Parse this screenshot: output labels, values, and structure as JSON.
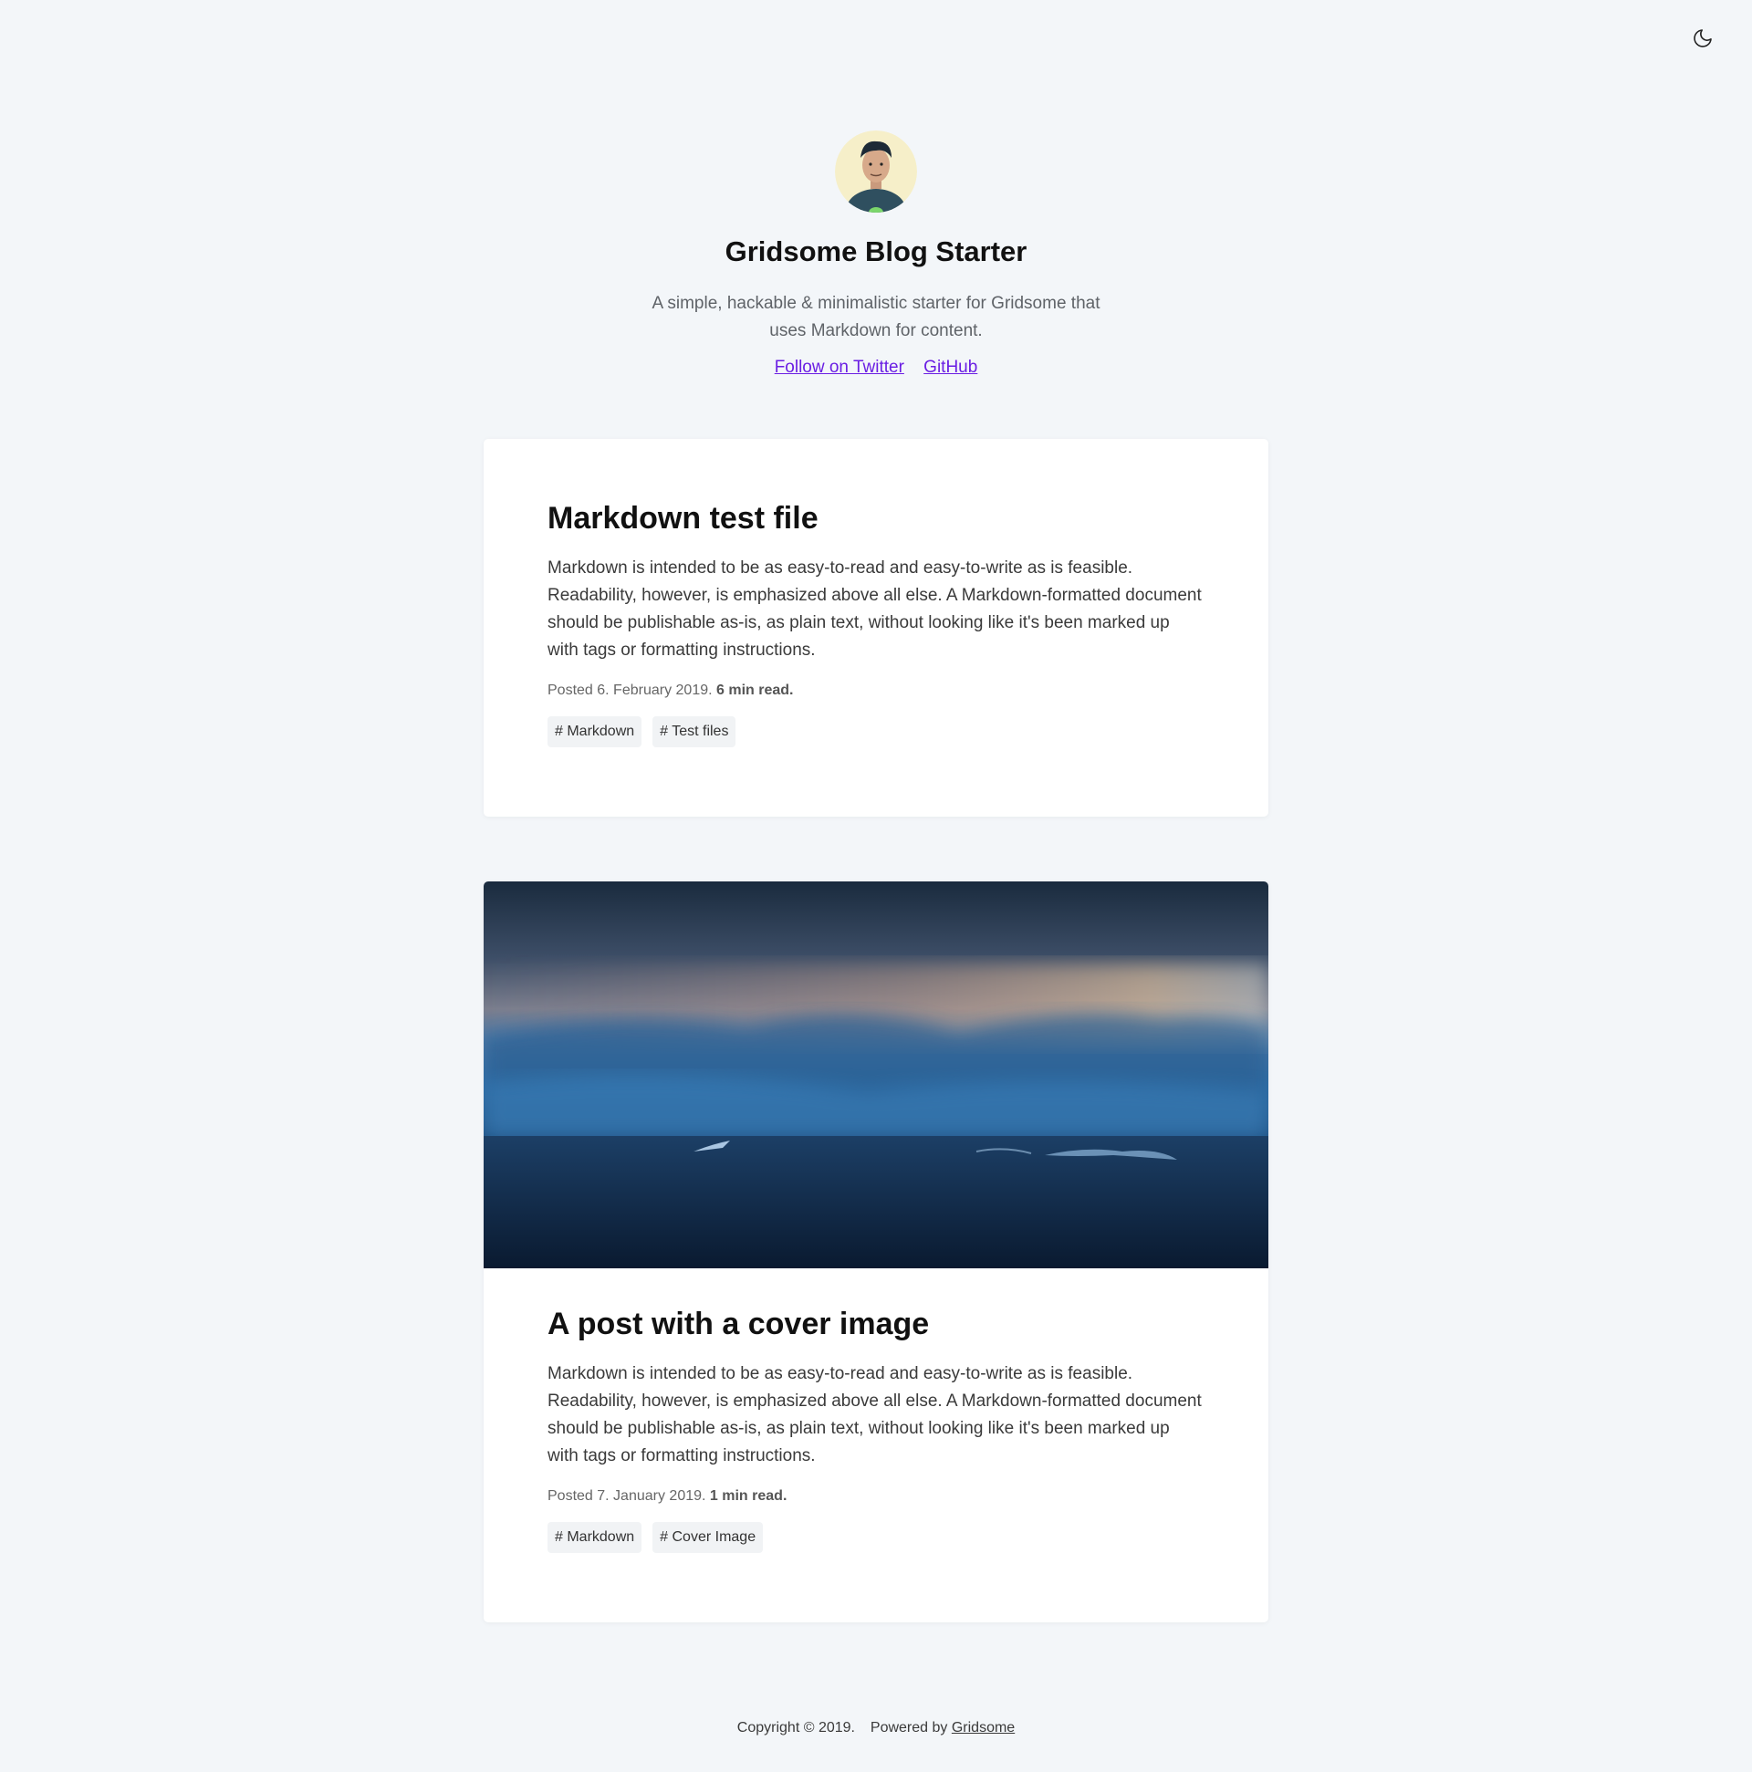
{
  "header": {
    "theme_toggle_icon": "moon-icon"
  },
  "author": {
    "avatar_icon": "avatar",
    "site_title": "Gridsome Blog Starter",
    "intro": "A simple, hackable & minimalistic starter for Gridsome that uses Markdown for content.",
    "links": [
      {
        "label": "Follow on Twitter"
      },
      {
        "label": "GitHub"
      }
    ]
  },
  "posts": [
    {
      "title": "Markdown test file",
      "description": "Markdown is intended to be as easy-to-read and easy-to-write as is feasible. Readability, however, is emphasized above all else. A Markdown-formatted document should be publishable as-is, as plain text, without looking like it's been marked up with tags or formatting instructions.",
      "posted": "Posted 6. February 2019.",
      "read_time": "6 min read.",
      "tags": [
        "# Markdown",
        "# Test files"
      ]
    },
    {
      "title": "A post with a cover image",
      "description": "Markdown is intended to be as easy-to-read and easy-to-write as is feasible. Readability, however, is emphasized above all else. A Markdown-formatted document should be publishable as-is, as plain text, without looking like it's been marked up with tags or formatting instructions.",
      "posted": "Posted 7. January 2019.",
      "read_time": "1 min read.",
      "tags": [
        "# Markdown",
        "# Cover Image"
      ]
    }
  ],
  "footer": {
    "copyright": "Copyright © 2019.",
    "powered_by": "Powered by",
    "powered_link": "Gridsome"
  },
  "colors": {
    "background": "#f3f6f9",
    "link": "#6a1ee3",
    "card": "#ffffff",
    "tag_bg": "#f1f3f5"
  }
}
